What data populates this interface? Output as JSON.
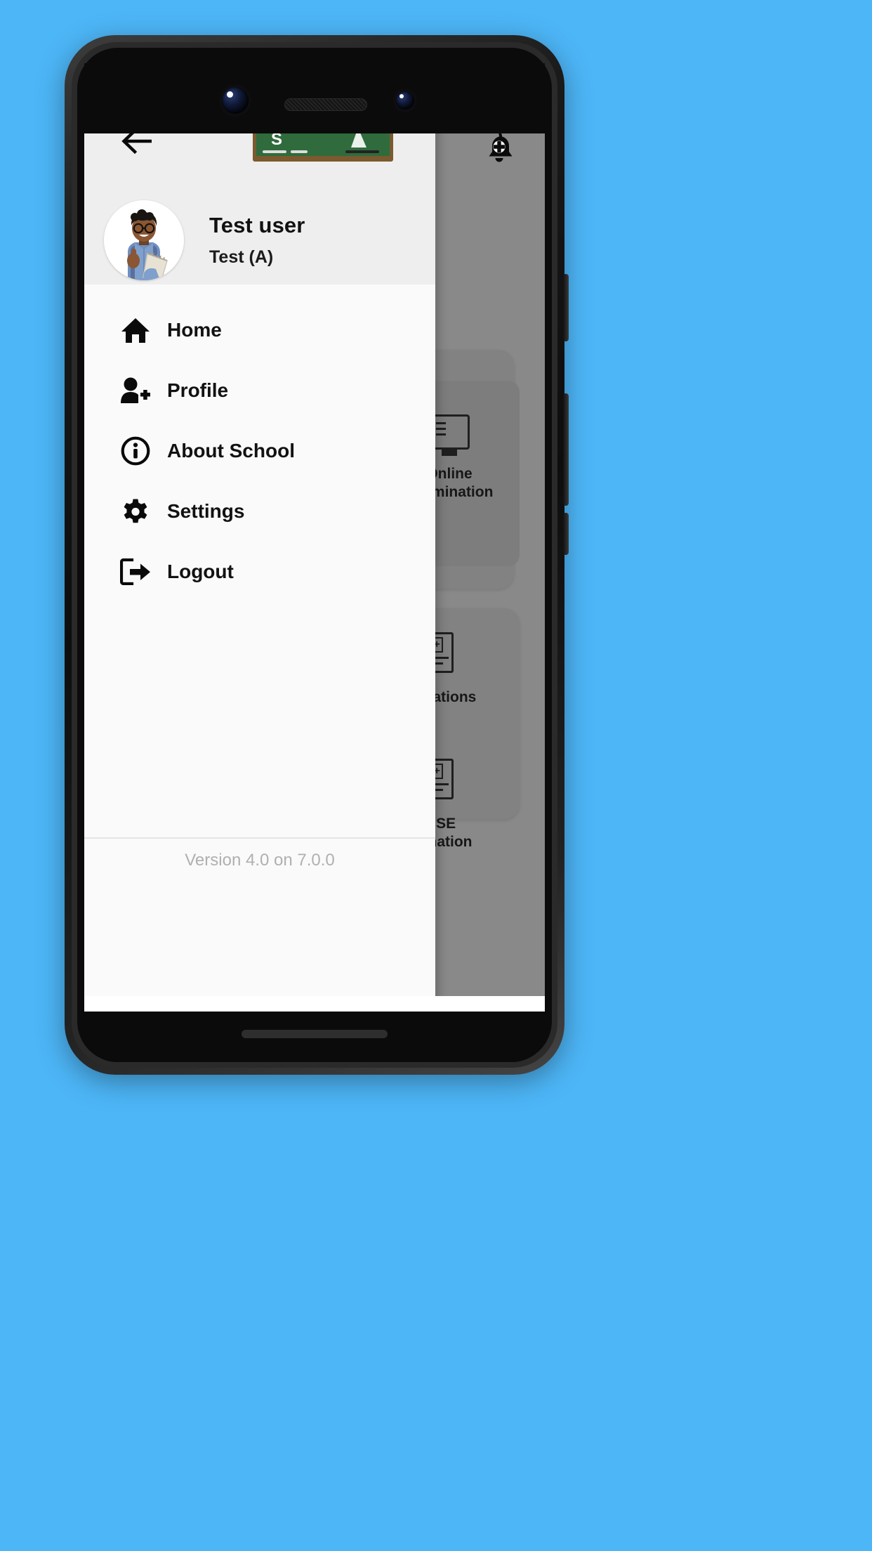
{
  "app": {
    "screen_background": "#fafafa",
    "appbar_background": "#eeeeee",
    "page_backdrop_color": "#4db6f7"
  },
  "appbar": {
    "back_icon": "arrow-left-icon",
    "logo": "school-chalkboard-logo",
    "notification_icon": "bell-add-icon"
  },
  "drawer_header": {
    "avatar": "student-avatar-photo",
    "user_name": "Test user",
    "user_class": "Test (A)"
  },
  "menu": {
    "items": [
      {
        "label": "Home",
        "icon": "home-icon"
      },
      {
        "label": "Profile",
        "icon": "person-add-icon"
      },
      {
        "label": "About School",
        "icon": "info-circle-icon"
      },
      {
        "label": "Settings",
        "icon": "gear-icon"
      },
      {
        "label": "Logout",
        "icon": "logout-icon"
      }
    ]
  },
  "footer": {
    "version_text": "Version 4.0 on 7.0.0"
  },
  "background": {
    "tiles": [
      {
        "label": "Online\nExamination",
        "icon": "online-exam-monitor-icon"
      },
      {
        "label": "...minations",
        "icon": "grade-report-icon"
      },
      {
        "label": "CBSE\n...mination",
        "icon": "grade-report-icon"
      }
    ]
  },
  "device": {
    "notch": {
      "camera_front": "front-camera-lens",
      "camera_secondary": "secondary-camera-lens",
      "earpiece": "earpiece-speaker-grille"
    },
    "home_indicator": "home-indicator-bar"
  }
}
